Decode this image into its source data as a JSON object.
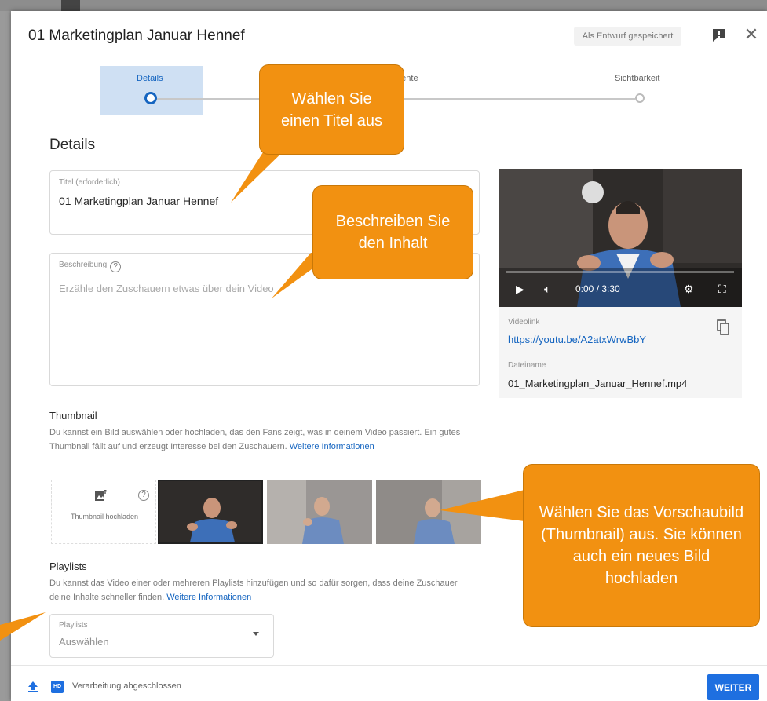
{
  "header": {
    "title": "01 Marketingplan Januar Hennef",
    "draft_status": "Als Entwurf gespeichert"
  },
  "stepper": {
    "steps": [
      {
        "label": "Details",
        "active": true
      },
      {
        "label": "mente",
        "active": false
      },
      {
        "label": "Sichtbarkeit",
        "active": false
      }
    ]
  },
  "details": {
    "section_title": "Details",
    "title_field": {
      "label": "Titel (erforderlich)",
      "value": "01 Marketingplan Januar Hennef"
    },
    "description_field": {
      "label": "Beschreibung",
      "placeholder": "Erzähle den Zuschauern etwas über dein Video"
    }
  },
  "video": {
    "time": "0:00 / 3:30",
    "link_label": "Videolink",
    "link": "https://youtu.be/A2atxWrwBbY",
    "filename_label": "Dateiname",
    "filename": "01_Marketingplan_Januar_Hennef.mp4"
  },
  "thumbnail": {
    "title": "Thumbnail",
    "description": "Du kannst ein Bild auswählen oder hochladen, das den Fans zeigt, was in deinem Video passiert. Ein gutes Thumbnail fällt auf und erzeugt Interesse bei den Zuschauern.",
    "more_link": "Weitere Informationen",
    "upload_label": "Thumbnail hochladen"
  },
  "playlists": {
    "title": "Playlists",
    "description": "Du kannst das Video einer oder mehreren Playlists hinzufügen und so dafür sorgen, dass deine Zuschauer deine Inhalte schneller finden.",
    "more_link": "Weitere Informationen",
    "select_label": "Playlists",
    "select_value": "Auswählen"
  },
  "footer": {
    "status": "Verarbeitung abgeschlossen",
    "hd_badge": "HD",
    "next_label": "WEITER"
  },
  "callouts": {
    "title_hint": "Wählen Sie einen Titel aus",
    "description_hint": "Beschreiben Sie den Inhalt",
    "thumbnail_hint": "Wählen Sie das Vorschaubild (Thumbnail) aus. Sie können auch ein neues Bild hochladen"
  },
  "colors": {
    "accent": "#1565c0",
    "button": "#1e6fe0",
    "callout": "#f29111"
  }
}
